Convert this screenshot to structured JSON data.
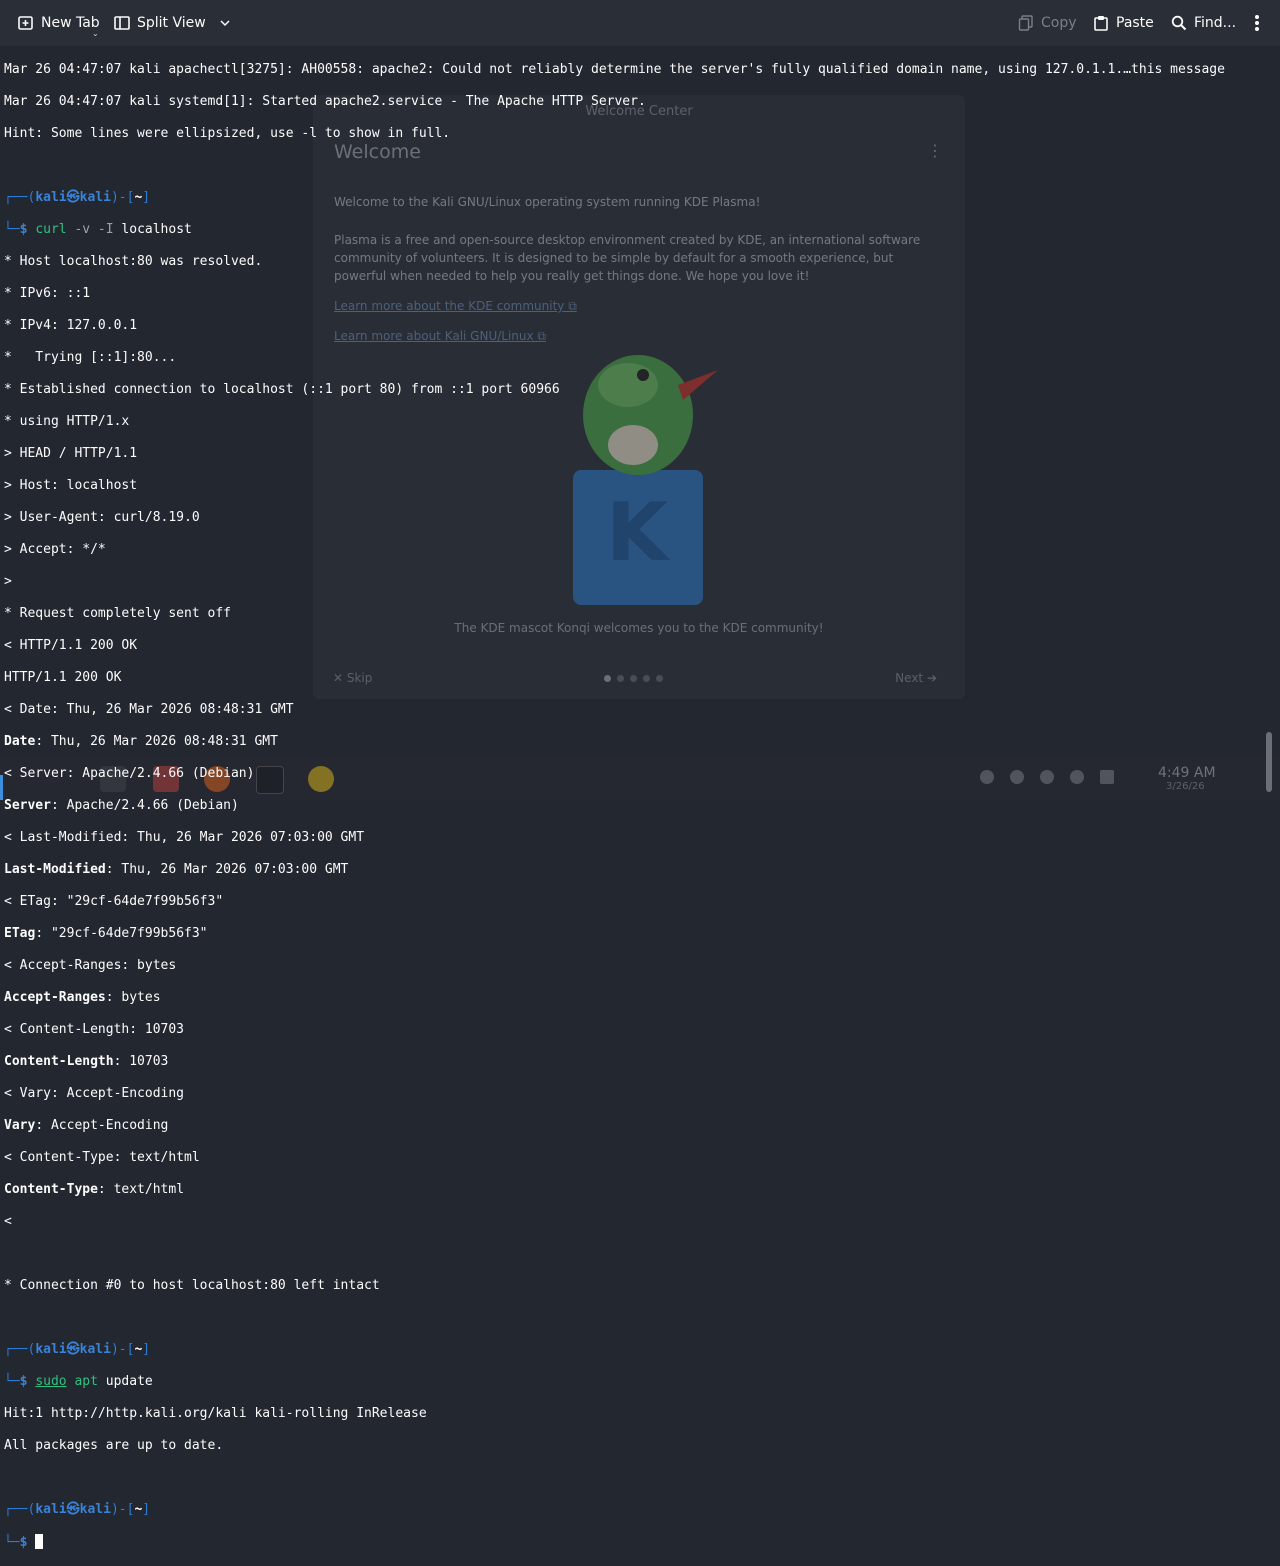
{
  "toolbar": {
    "new_tab": "New Tab",
    "split_view": "Split View",
    "copy": "Copy",
    "paste": "Paste",
    "find": "Find..."
  },
  "prompt": {
    "user": "kali",
    "host": "kali",
    "dir": "~",
    "at_glyph": "㉿"
  },
  "terminal": {
    "l1": "Mar 26 04:47:07 kali apachectl[3275]: AH00558: apache2: Could not reliably determine the server's fully qualified domain name, using 127.0.1.1.…this message",
    "l2": "Mar 26 04:47:07 kali systemd[1]: Started apache2.service - The Apache HTTP Server.",
    "l3": "Hint: Some lines were ellipsized, use -l to show in full.",
    "curl_cmd": "curl",
    "curl_opts": "-v -I",
    "curl_arg": "localhost",
    "out": [
      "* Host localhost:80 was resolved.",
      "* IPv6: ::1",
      "* IPv4: 127.0.0.1",
      "*   Trying [::1]:80...",
      "* Established connection to localhost (::1 port 80) from ::1 port 60966",
      "* using HTTP/1.x",
      "> HEAD / HTTP/1.1",
      "> Host: localhost",
      "> User-Agent: curl/8.19.0",
      "> Accept: */*",
      ">",
      "* Request completely sent off",
      "< HTTP/1.1 200 OK",
      "HTTP/1.1 200 OK",
      "< Date: Thu, 26 Mar 2026 08:48:31 GMT"
    ],
    "date_k": "Date",
    "date_v": ": Thu, 26 Mar 2026 08:48:31 GMT",
    "srv_raw": "< Server: Apache/2.4.66 (Debian)",
    "srv_k": "Server",
    "srv_v": ": Apache/2.4.66 (Debian)",
    "lm_raw": "< Last-Modified: Thu, 26 Mar 2026 07:03:00 GMT",
    "lm_k": "Last-Modified",
    "lm_v": ": Thu, 26 Mar 2026 07:03:00 GMT",
    "et_raw": "< ETag: \"29cf-64de7f99b56f3\"",
    "et_k": "ETag",
    "et_v": ": \"29cf-64de7f99b56f3\"",
    "ar_raw": "< Accept-Ranges: bytes",
    "ar_k": "Accept-Ranges",
    "ar_v": ": bytes",
    "cl_raw": "< Content-Length: 10703",
    "cl_k": "Content-Length",
    "cl_v": ": 10703",
    "vy_raw": "< Vary: Accept-Encoding",
    "vy_k": "Vary",
    "vy_v": ": Accept-Encoding",
    "ct_raw": "< Content-Type: text/html",
    "ct_k": "Content-Type",
    "ct_v": ": text/html",
    "lt": "<",
    "conn": "* Connection #0 to host localhost:80 left intact",
    "sudo": "sudo",
    "apt": "apt",
    "apt_arg": "update",
    "hit": "Hit:1 http://http.kali.org/kali kali-rolling InRelease",
    "uptodate": "All packages are up to date."
  },
  "ghost_window": {
    "title": "Welcome Center",
    "heading": "Welcome",
    "p1": "Welcome to the Kali GNU/Linux operating system running KDE Plasma!",
    "p2": "Plasma is a free and open-source desktop environment created by KDE, an international software community of volunteers. It is designed to be simple by default for a smooth experience, but powerful when needed to help you really get things done. We hope you love it!",
    "link1": "Learn more about the KDE community ⧉",
    "link2": "Learn more about Kali GNU/Linux ⧉",
    "caption": "The KDE mascot Konqi welcomes you to the KDE community!",
    "skip": "✕  Skip",
    "next": "Next  ➔"
  },
  "taskbar": {
    "time": "4:49 AM",
    "date": "3/26/26"
  },
  "colors": {
    "prompt_box": "#2d7cd3",
    "prompt_user": "#3b82d6",
    "command": "#2ec27e",
    "background": "#232730"
  }
}
